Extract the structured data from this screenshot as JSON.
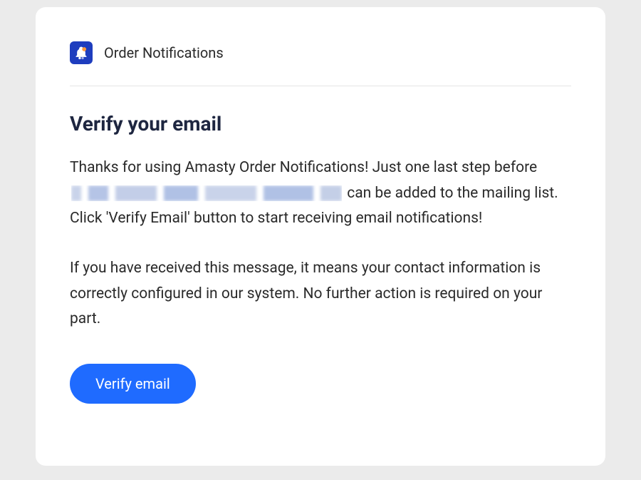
{
  "header": {
    "brand_label": "Order Notifications"
  },
  "content": {
    "title": "Verify your email",
    "intro_part1": "Thanks for using Amasty Order Notifications! Just one last step before ",
    "intro_part2": " can be added to the mailing list. Click 'Verify Email' button to start receiving email notifications!",
    "info": "If you have received this message, it means your contact information is correctly configured in our system. No further action is required on your part."
  },
  "button": {
    "verify_label": "Verify email"
  }
}
